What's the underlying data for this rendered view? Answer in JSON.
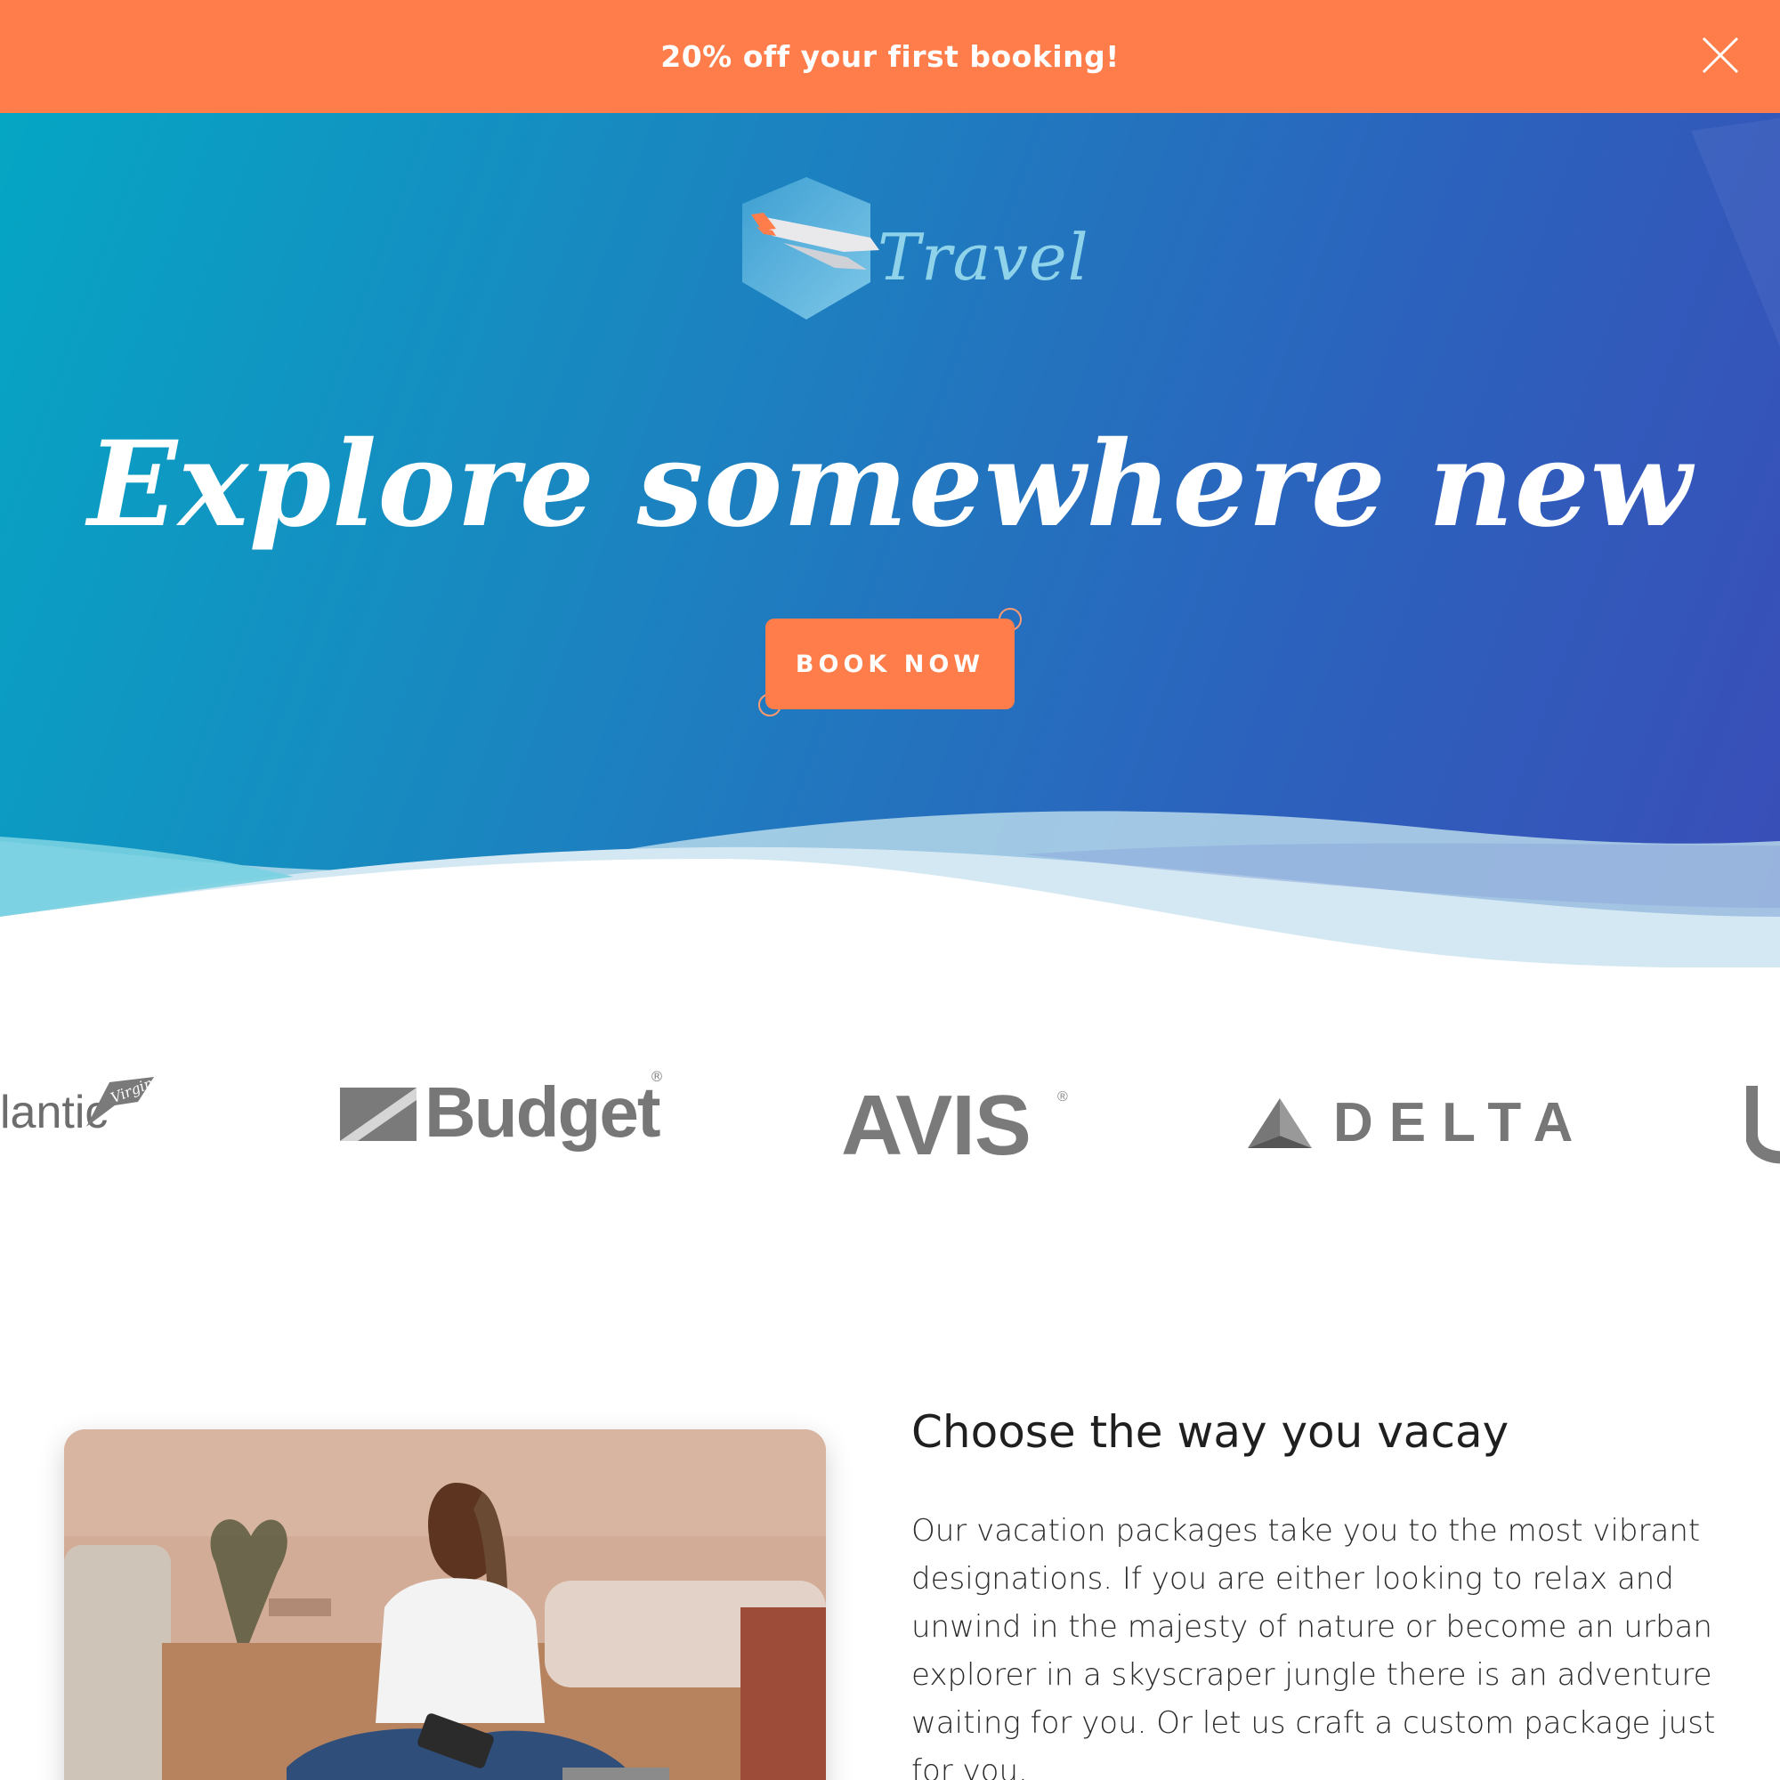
{
  "promo": {
    "text": "20% off your first booking!",
    "close_icon": "close-icon"
  },
  "hero": {
    "logo_text": "Travel",
    "title": "Explore somewhere new",
    "cta_label": "BOOK NOW"
  },
  "brands": {
    "virgin_text": "lantic",
    "virgin_script": "Virgin",
    "budget": "Budget",
    "avis": "AVIS",
    "delta": "DELTA",
    "registered": "®"
  },
  "content": {
    "title": "Choose the way you vacay",
    "body": "Our vacation packages take you to the most vibrant designations. If you are either looking to relax and unwind in the majesty of nature or become an urban explorer in a skyscraper jungle there is an adventure waiting for you. Or let us craft a custom package just for you."
  },
  "colors": {
    "accent": "#ff7d4a",
    "hero_start": "#05a6c4",
    "hero_end": "#3a4db8",
    "logo_text": "#8fd3ea",
    "brand_gray": "#777777"
  }
}
